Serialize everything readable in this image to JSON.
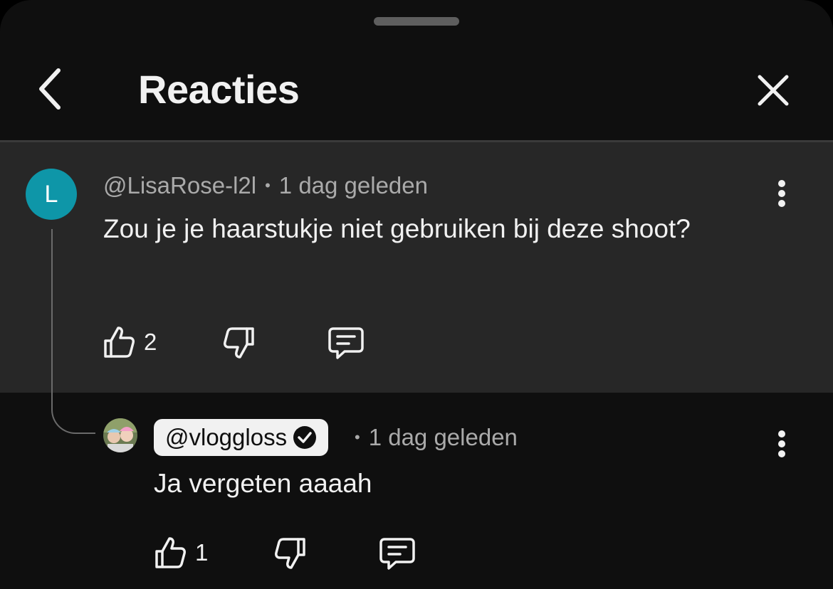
{
  "header": {
    "title": "Reacties"
  },
  "comments": [
    {
      "avatar_letter": "L",
      "author": "@LisaRose-l2l",
      "separator": "•",
      "time": "1 dag geleden",
      "text": "Zou je je haarstukje niet gebruiken bij deze shoot?",
      "likes": "2"
    }
  ],
  "replies": [
    {
      "author": "@vloggloss",
      "separator": "•",
      "time": "1 dag geleden",
      "text": "Ja vergeten aaaah",
      "likes": "1"
    }
  ],
  "colors": {
    "highlight_bg": "#272727",
    "avatar_bg": "#0e96a8",
    "chip_bg": "#f1f1f1"
  },
  "icons": [
    "chevron-left-icon",
    "close-icon",
    "more-vert-icon",
    "thumb-up-icon",
    "thumb-down-icon",
    "reply-icon",
    "verified-icon"
  ]
}
